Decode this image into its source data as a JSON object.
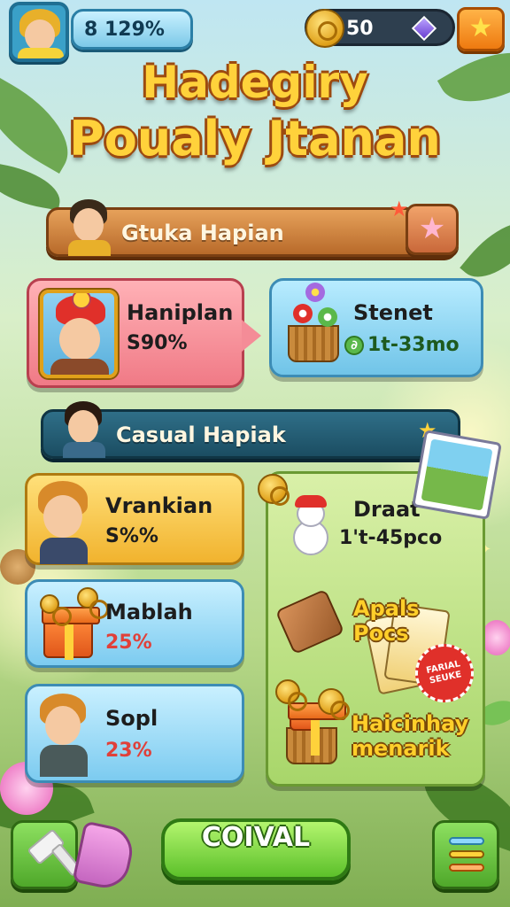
{
  "header": {
    "progress_text": "8 129%",
    "coins": "50",
    "icons": [
      "player-avatar-icon",
      "coin-icon",
      "gem-icon",
      "star-icon"
    ]
  },
  "title": {
    "line1": "Hadegiry",
    "line2": "Poualy Jtanan"
  },
  "section1": {
    "label": "Gtuka Hapian",
    "featured": {
      "name": "Haniplan",
      "value": "S90%"
    },
    "side": {
      "name": "Stenet",
      "value": "1t-33mo"
    }
  },
  "section2": {
    "label": "Casual Hapiak",
    "items": [
      {
        "name": "Vrankian",
        "value": "S%%"
      },
      {
        "name": "Mablah",
        "value": "25%"
      },
      {
        "name": "Sopl",
        "value": "23%"
      }
    ],
    "panel": {
      "name": "Draat",
      "value": "1't-45pco",
      "promo1": "Apals\nPocs",
      "seal": "FARIAL\nSEUKE",
      "promo2": "Haicinhay\nmenarik"
    }
  },
  "footer": {
    "play_label": "COIVAL"
  },
  "colors": {
    "title": "#ffd23b",
    "play": "#5cc02a",
    "banner1": "#b86a2a",
    "banner2": "#1b4d62"
  }
}
